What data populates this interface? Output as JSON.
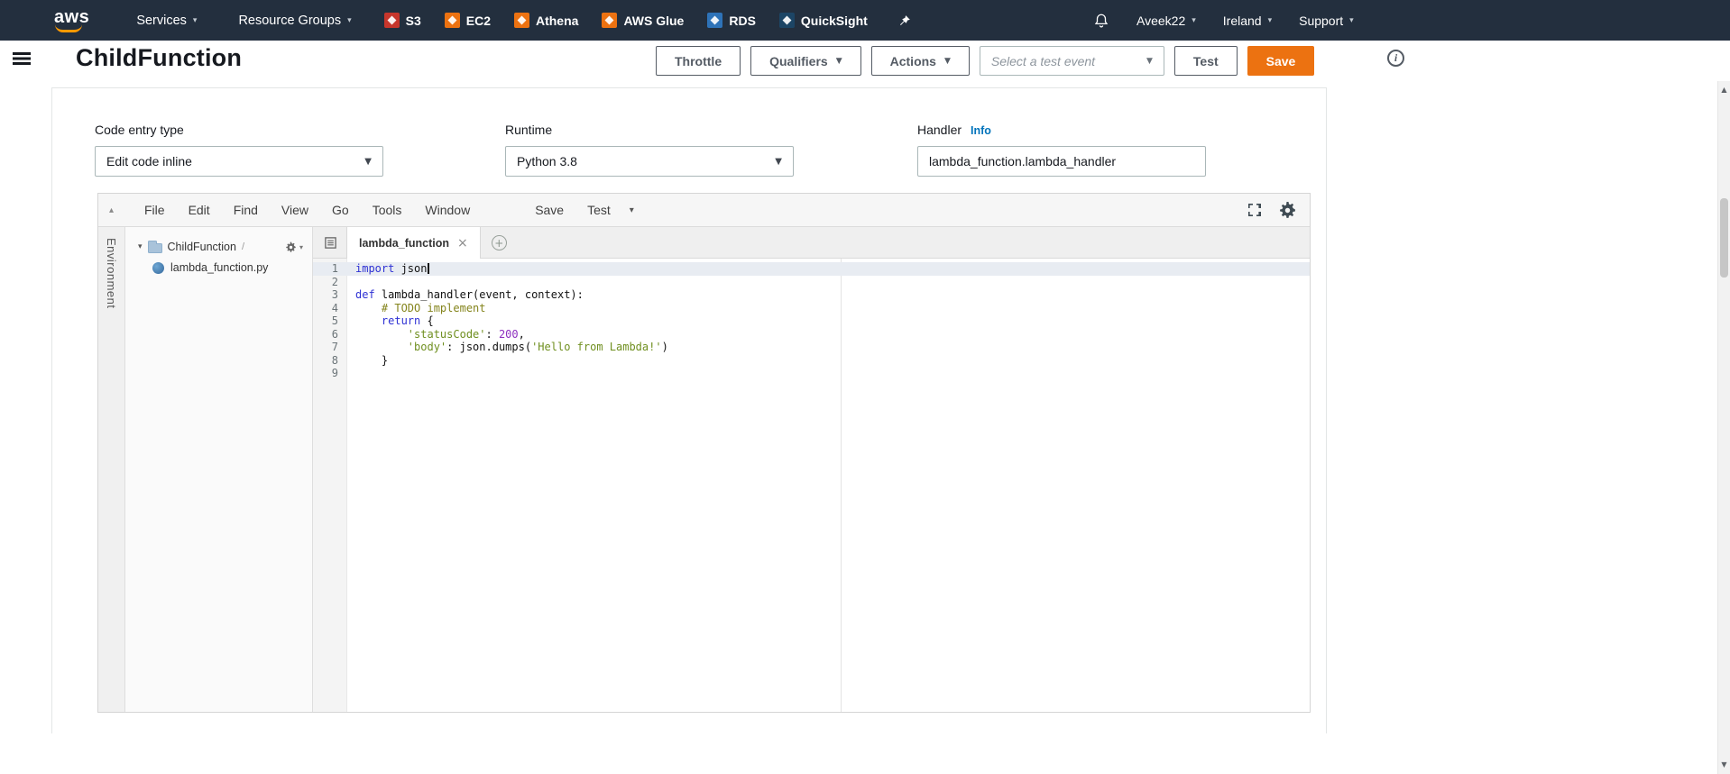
{
  "icons": {
    "caret_down": "▾",
    "caret_select": "▼",
    "close": "×",
    "plus": "+",
    "collapse_up": "▴",
    "info_letter": "i",
    "scroll_up": "▲",
    "scroll_down": "▼",
    "hamburger": "css-bars",
    "bell": "svg-bell",
    "pin": "svg-pushpin",
    "gear": "svg-gear",
    "expand": "svg-expand",
    "tab_list": "svg-doc-list",
    "folder": "css-folder",
    "python_file": "css-circle",
    "service_glyph": "css-diamond"
  },
  "nav": {
    "logo_text": "aws",
    "menus": [
      {
        "label": "Services"
      },
      {
        "label": "Resource Groups"
      }
    ],
    "pinned_services": [
      {
        "label": "S3",
        "icon": "s3-icon",
        "color": "#c7362c"
      },
      {
        "label": "EC2",
        "icon": "ec2-icon",
        "color": "#ec7211"
      },
      {
        "label": "Athena",
        "icon": "athena-icon",
        "color": "#ec7211"
      },
      {
        "label": "AWS Glue",
        "icon": "aws-glue-icon",
        "color": "#ec7211"
      },
      {
        "label": "RDS",
        "icon": "rds-icon",
        "color": "#2e73b8"
      },
      {
        "label": "QuickSight",
        "icon": "quicksight-icon",
        "color": "#1c4565"
      }
    ],
    "account": "Aveek22",
    "region": "Ireland",
    "support": "Support"
  },
  "header": {
    "title": "ChildFunction",
    "buttons": {
      "throttle": "Throttle",
      "qualifiers": "Qualifiers",
      "actions": "Actions",
      "test": "Test",
      "save": "Save"
    },
    "test_event_placeholder": "Select a test event"
  },
  "config": {
    "code_entry_label": "Code entry type",
    "code_entry_value": "Edit code inline",
    "runtime_label": "Runtime",
    "runtime_value": "Python 3.8",
    "handler_label": "Handler",
    "handler_info": "Info",
    "handler_value": "lambda_function.lambda_handler"
  },
  "editor": {
    "menu_items": [
      "File",
      "Edit",
      "Find",
      "View",
      "Go",
      "Tools",
      "Window"
    ],
    "action_save": "Save",
    "action_test": "Test",
    "env_label": "Environment",
    "tree": {
      "folder": "ChildFunction",
      "path_sep": "/",
      "file": "lambda_function.py"
    },
    "tab_label": "lambda_function",
    "syntax_colors": {
      "k": "#2e31d4",
      "c": "#84841c",
      "s": "#6f8f1f",
      "n": "#8d2fbf",
      "p": "#121212"
    },
    "code_lines": [
      {
        "num": "1",
        "tokens": [
          [
            "k",
            "import"
          ],
          [
            "p",
            " json"
          ]
        ],
        "active": true,
        "cursor": true
      },
      {
        "num": "2",
        "tokens": []
      },
      {
        "num": "3",
        "tokens": [
          [
            "k",
            "def"
          ],
          [
            "p",
            " lambda_handler(event, context):"
          ]
        ]
      },
      {
        "num": "4",
        "tokens": [
          [
            "c",
            "    # TODO implement"
          ]
        ]
      },
      {
        "num": "5",
        "tokens": [
          [
            "p",
            "    "
          ],
          [
            "k",
            "return"
          ],
          [
            "p",
            " {"
          ]
        ]
      },
      {
        "num": "6",
        "tokens": [
          [
            "p",
            "        "
          ],
          [
            "s",
            "'statusCode'"
          ],
          [
            "p",
            ": "
          ],
          [
            "n",
            "200"
          ],
          [
            "p",
            ","
          ]
        ]
      },
      {
        "num": "7",
        "tokens": [
          [
            "p",
            "        "
          ],
          [
            "s",
            "'body'"
          ],
          [
            "p",
            ": json.dumps("
          ],
          [
            "s",
            "'Hello from Lambda!'"
          ],
          [
            "p",
            ")"
          ]
        ]
      },
      {
        "num": "8",
        "tokens": [
          [
            "p",
            "    }"
          ]
        ]
      },
      {
        "num": "9",
        "tokens": []
      }
    ]
  }
}
